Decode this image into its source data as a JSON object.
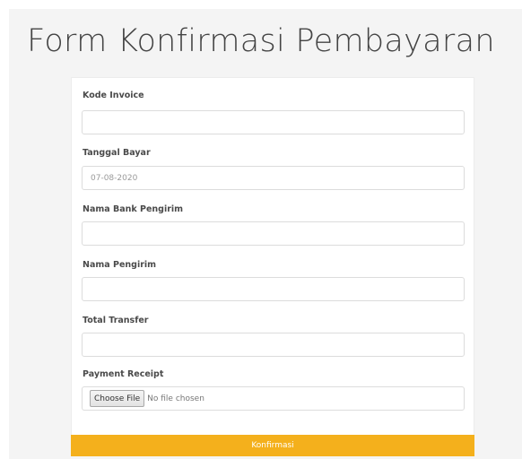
{
  "page": {
    "title": "Form Konfirmasi Pembayaran"
  },
  "form": {
    "fields": [
      {
        "label": "Kode Invoice",
        "value": ""
      },
      {
        "label": "Tanggal Bayar",
        "value": "07-08-2020"
      },
      {
        "label": "Nama Bank Pengirim",
        "value": ""
      },
      {
        "label": "Nama Pengirim",
        "value": ""
      },
      {
        "label": "Total Transfer",
        "value": ""
      }
    ],
    "receipt": {
      "label": "Payment Receipt",
      "button_label": "Choose File",
      "status": "No file chosen"
    },
    "submit_label": "Konfirmasi"
  },
  "colors": {
    "accent": "#f4b01c",
    "page_background": "#f4f4f4",
    "card_background": "#ffffff"
  }
}
